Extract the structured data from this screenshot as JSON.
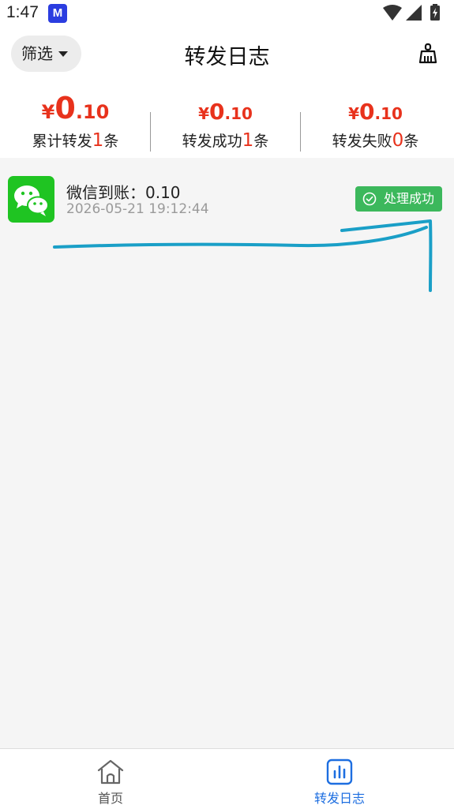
{
  "status_bar": {
    "time": "1:47",
    "app_icon_letter": "M",
    "icons": [
      "wifi-icon",
      "signal-icon",
      "battery-charging-icon"
    ]
  },
  "header": {
    "filter_label": "筛选",
    "title": "转发日志",
    "clear_icon": "broom-icon"
  },
  "stats": [
    {
      "currency": "¥",
      "amount_int": "0",
      "amount_dec": ".10",
      "label_prefix": "累计转发",
      "count": "1",
      "label_suffix": "条"
    },
    {
      "currency": "¥",
      "amount_int": "0",
      "amount_dec": ".10",
      "label_prefix": "转发成功",
      "count": "1",
      "label_suffix": "条"
    },
    {
      "currency": "¥",
      "amount_int": "0",
      "amount_dec": ".10",
      "label_prefix": "转发失败",
      "count": "0",
      "label_suffix": "条"
    }
  ],
  "log": [
    {
      "icon": "wechat-icon",
      "title": "微信到账：0.10",
      "time": "2026-05-21 19:12:44",
      "status": "处理成功"
    }
  ],
  "bottom_nav": [
    {
      "label": "首页",
      "icon": "home-icon",
      "active": false
    },
    {
      "label": "转发日志",
      "icon": "bar-chart-icon",
      "active": true
    }
  ],
  "colors": {
    "accent_red": "#e8321c",
    "success_green": "#3cb85c",
    "wechat_green": "#1fc422",
    "active_blue": "#1d6ee0",
    "annotation_cyan": "#1a9fc7"
  }
}
